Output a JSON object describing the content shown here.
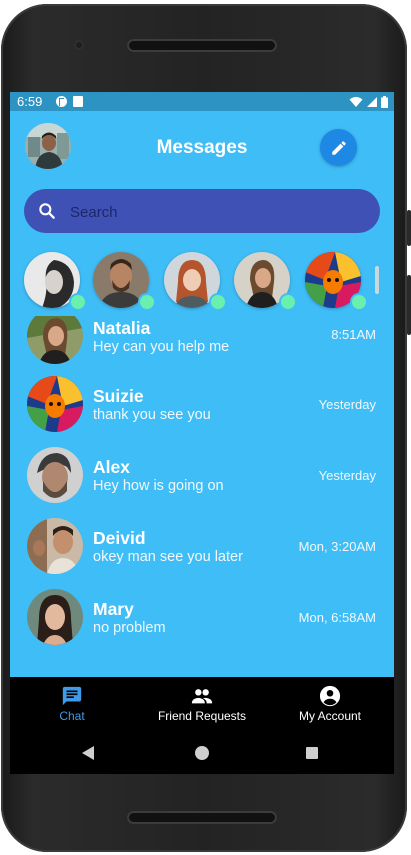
{
  "statusbar": {
    "time": "6:59"
  },
  "header": {
    "title": "Messages"
  },
  "search": {
    "placeholder": "Search"
  },
  "stories": [
    {
      "name": "story-1",
      "online": true
    },
    {
      "name": "story-2",
      "online": true
    },
    {
      "name": "story-3",
      "online": true
    },
    {
      "name": "story-4",
      "online": true
    },
    {
      "name": "story-5",
      "online": true
    }
  ],
  "chats": [
    {
      "name": "Natalia",
      "message": "Hey can you help me",
      "time": "8:51AM"
    },
    {
      "name": "Suizie",
      "message": "thank you see you",
      "time": "Yesterday"
    },
    {
      "name": "Alex",
      "message": "Hey how is going on",
      "time": "Yesterday"
    },
    {
      "name": "Deivid",
      "message": "okey man see you later",
      "time": "Mon, 3:20AM"
    },
    {
      "name": "Mary",
      "message": "no problem",
      "time": "Mon, 6:58AM"
    }
  ],
  "nav": {
    "chat": "Chat",
    "friend_requests": "Friend Requests",
    "my_account": "My Account"
  },
  "colors": {
    "background": "#3fbdf7",
    "search_bar": "#3f51b5",
    "compose_button": "#1e88e5",
    "online_dot": "#69f0ae",
    "active_nav": "#3f9ae8"
  }
}
